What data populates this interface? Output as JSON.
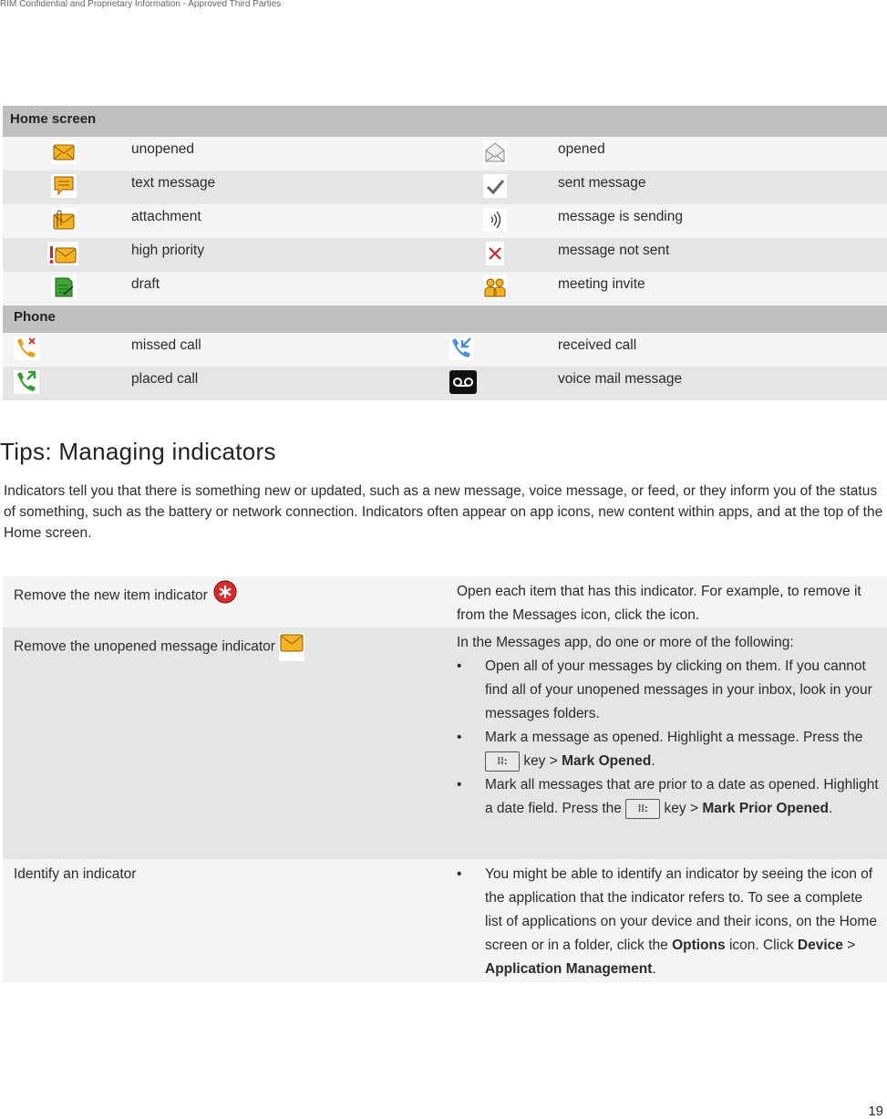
{
  "confidential": "RIM Confidential and Proprietary Information - Approved Third Parties",
  "home": {
    "header": "Home screen",
    "rows": [
      {
        "icon1": "unopened-envelope-icon",
        "label1": "unopened",
        "icon2": "opened-envelope-icon",
        "label2": "opened"
      },
      {
        "icon1": "text-message-icon",
        "label1": "text message",
        "icon2": "checkmark-icon",
        "label2": "sent message"
      },
      {
        "icon1": "attachment-icon",
        "label1": "attachment",
        "icon2": "sending-waves-icon",
        "label2": "message is sending"
      },
      {
        "icon1": "high-priority-icon",
        "label1": "high priority",
        "icon2": "red-x-icon",
        "label2": "message not sent"
      },
      {
        "icon1": "draft-icon",
        "label1": "draft",
        "icon2": "meeting-invite-icon",
        "label2": "meeting invite"
      }
    ]
  },
  "phone": {
    "header": "Phone",
    "rows": [
      {
        "icon1": "missed-call-icon",
        "label1": "missed call",
        "icon2": "received-call-icon",
        "label2": "received call"
      },
      {
        "icon1": "placed-call-icon",
        "label1": "placed call",
        "icon2": "voicemail-icon",
        "label2": "voice mail message"
      }
    ]
  },
  "tips": {
    "title": "Tips: Managing indicators",
    "intro": "Indicators tell you that there is something new or updated, such as a new message, voice message, or feed, or they inform you of the status of something, such as the battery or network connection. Indicators often appear on app icons, new content within apps, and at the top of the Home screen.",
    "rows": [
      {
        "task": "Remove the new item indicator",
        "desc": "Open each item that has this indicator. For example, to remove it from the Messages icon, click the icon."
      },
      {
        "task": "Remove the unopened message indicator",
        "desc": "In the Messages app, do one or more of the following:",
        "b1": "Open all of your messages by clicking on them. If you cannot find all of your unopened messages in your inbox, look in your messages folders.",
        "b2a": "Mark a message as opened. Highlight a message. Press the",
        "b2b": "key >",
        "b2c": "Mark Opened",
        "b3a": "Mark all messages that are prior to a date as opened. Highlight a date field. Press the",
        "b3b": "key >",
        "b3c": "Mark Prior Opened"
      },
      {
        "task": "Identify an indicator",
        "b1a": "You might be able to identify an indicator by seeing the icon of the application that the indicator refers to. To see a complete list of applications on your device and their icons, on the Home screen or in a folder, click the",
        "b1b": "Options",
        "b1c": "icon. Click",
        "b1d": "Device",
        "b1e": ">",
        "b1f": "Application Management"
      }
    ]
  },
  "bullet": "•",
  "period": ".",
  "key_glyph": "⁞⁞:",
  "page_number": "19"
}
